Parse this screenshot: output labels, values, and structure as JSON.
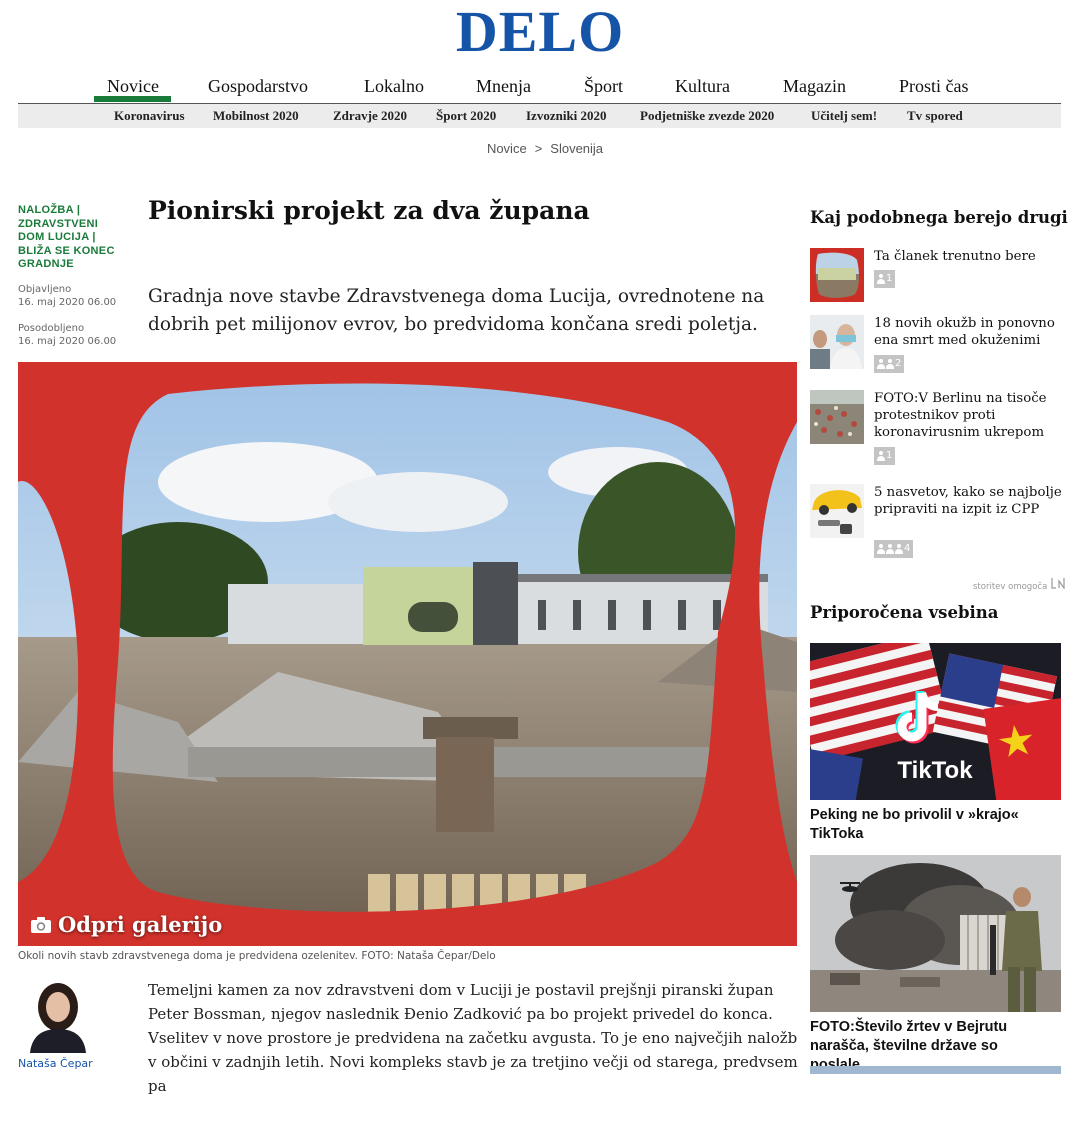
{
  "logo": "DELO",
  "main_nav": [
    {
      "label": "Novice",
      "active": true
    },
    {
      "label": "Gospodarstvo"
    },
    {
      "label": "Lokalno"
    },
    {
      "label": "Mnenja"
    },
    {
      "label": "Šport"
    },
    {
      "label": "Kultura"
    },
    {
      "label": "Magazin"
    },
    {
      "label": "Prosti čas"
    }
  ],
  "sub_nav": [
    "Koronavirus",
    "Mobilnost 2020",
    "Zdravje 2020",
    "Šport 2020",
    "Izvozniki 2020",
    "Podjetniške zvezde 2020",
    "Učitelj sem!",
    "Tv spored"
  ],
  "breadcrumb": {
    "first": "Novice",
    "separator": ">",
    "second": "Slovenija"
  },
  "article": {
    "kicker": "NALOŽBA | ZDRAVSTVENI DOM LUCIJA | BLIŽA SE KONEC GRADNJE",
    "published_label": "Objavljeno",
    "published_date": "16. maj 2020 06.00",
    "updated_label": "Posodobljeno",
    "updated_date": "16. maj 2020 06.00",
    "title": "Pionirski projekt za dva župana",
    "lead": "Gradnja nove stavbe Zdravstvenega doma Lucija, ovrednotene na dobrih pet milijonov evrov, bo predvidoma končana sredi poletja.",
    "gallery_label": "Odpri galerijo",
    "caption": "Okoli novih stavb zdravstvenega doma je predvidena ozelenitev. FOTO: Nataša Čepar/Delo",
    "author": "Nataša Čepar",
    "body": "Temeljni kamen za nov zdravstveni dom v Luciji je postavil prejšnji piranski župan Peter Bossman, njegov naslednik Đenio Zadković pa bo projekt privedel do konca. Vselitev v nove prostore je predvidena na začetku avgusta. To je eno največjih naložb v občini v zadnjih letih. Novi kompleks stavb je za tretjino večji od starega, predvsem pa"
  },
  "sidebar": {
    "similar_heading": "Kaj podobnega berejo drugi",
    "similar": [
      {
        "title": "Ta članek trenutno bere",
        "readers": "1",
        "icon_count": 1
      },
      {
        "title": "18 novih okužb in ponovno ena smrt med okuženimi",
        "readers": "2",
        "icon_count": 2
      },
      {
        "title": "FOTO:V Berlinu na tisoče protestnikov proti koronavirusnim ukrepom",
        "readers": "1",
        "icon_count": 1
      },
      {
        "title": "5 nasvetov, kako se najbolje pripraviti na izpit iz CPP",
        "readers": "4",
        "icon_count": 3
      }
    ],
    "powered_by": "storitev omogoča",
    "recommended_heading": "Priporočena vsebina",
    "recommended": [
      {
        "title": "Peking ne bo privolil v »krajo« TikToka",
        "logo_text": "TikTok"
      },
      {
        "title": "FOTO:Število žrtev v Bejrutu narašča, številne države so poslale..."
      }
    ]
  },
  "colors": {
    "brand": "#1654a8",
    "accent_green": "#1a7a3a",
    "subnav_bg": "#ececec"
  }
}
